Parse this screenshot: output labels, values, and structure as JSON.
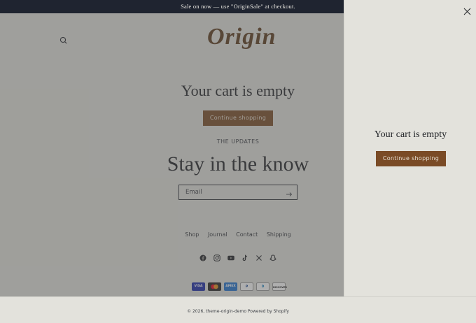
{
  "announcement": "Sale on now — use \"OriginSale\" at checkout.",
  "brand": "Origin",
  "cart": {
    "title": "Your cart is empty",
    "continue_label": "Continue shopping"
  },
  "newsletter": {
    "kicker": "THE UPDATES",
    "title": "Stay in the know",
    "email_placeholder": "Email"
  },
  "footer": {
    "links": [
      "Shop",
      "Journal",
      "Contact",
      "Shipping"
    ],
    "socials": [
      "facebook-icon",
      "instagram-icon",
      "youtube-icon",
      "tiktok-icon",
      "x-icon",
      "snapchat-icon"
    ],
    "payments": [
      "VISA",
      "MC",
      "AMEX",
      "P",
      "D",
      "DISCOVER"
    ],
    "copyright": "© 2026, theme-origin-demo Powered by Shopify"
  },
  "drawer": {
    "title": "Your cart is empty",
    "continue_label": "Continue shopping"
  },
  "colors": {
    "background": "#e3e2dc",
    "announcement_bg": "#1f2430",
    "accent": "#7a4b26",
    "overlay": "rgba(85,85,85,0.48)"
  }
}
